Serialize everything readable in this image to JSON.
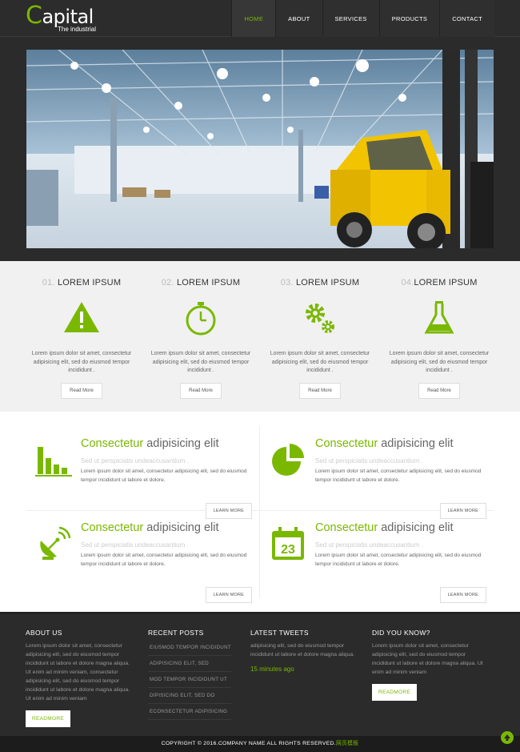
{
  "header": {
    "logo_first": "C",
    "logo_rest": "apital",
    "logo_sub": "The industrial",
    "nav": [
      "HOME",
      "ABOUT",
      "SERVICES",
      "PRODUCTS",
      "CONTACT"
    ]
  },
  "features": [
    {
      "num": "01.",
      "title": "LOREM IPSUM",
      "icon": "warning-icon",
      "text": "Lorem ipsum dolor sit amet, consectetur adipisicing elit, sed do eiusmod tempor incididunt .",
      "button": "Read More"
    },
    {
      "num": "02.",
      "title": "LOREM IPSUM",
      "icon": "stopwatch-icon",
      "text": "Lorem ipsum dolor sit amet, consectetur adipisicing elit, sed do eiusmod tempor incididunt .",
      "button": "Read More"
    },
    {
      "num": "03.",
      "title": "LOREM IPSUM",
      "icon": "gears-icon",
      "text": "Lorem ipsum dolor sit amet, consectetur adipisicing elit, sed do eiusmod tempor incididunt .",
      "button": "Read More"
    },
    {
      "num": "04.",
      "title": "LOREM IPSUM",
      "icon": "flask-icon",
      "text": "Lorem ipsum dolor sit amet, consectetur adipisicing elit, sed do eiusmod tempor incididunt .",
      "button": "Read More"
    }
  ],
  "services": [
    {
      "title_green": "Consectetur",
      "title_rest": " adipisicing elit",
      "sub": "Sed ut perspiciatis undeaccusantium .",
      "text": "Lorem ipsum dolor sit amet, consectetur adipisicing elit, sed do eiusmod tempor incididunt ut labore et dolore.",
      "button": "LEARN MORE",
      "icon": "bar-chart-icon"
    },
    {
      "title_green": "Consectetur",
      "title_rest": " adipisicing elit",
      "sub": "Sed ut perspiciatis undeaccusantium .",
      "text": "Lorem ipsum dolor sit amet, consectetur adipisicing elit, sed do eiusmod tempor incididunt ut labore et dolore.",
      "button": "LEARN MORE",
      "icon": "pie-chart-icon"
    },
    {
      "title_green": "Consectetur",
      "title_rest": " adipisicing elit",
      "sub": "Sed ut perspiciatis undeaccusantium .",
      "text": "Lorem ipsum dolor sit amet, consectetur adipisicing elit, sed do eiusmod tempor incididunt ut labore et dolore.",
      "button": "LEARN MORE",
      "icon": "satellite-dish-icon"
    },
    {
      "title_green": "Consectetur",
      "title_rest": " adipisicing elit",
      "sub": "Sed ut perspiciatis undeaccusantium .",
      "text": "Lorem ipsum dolor sit amet, consectetur adipisicing elit, sed do eiusmod tempor incididunt ut labore et dolore.",
      "button": "LEARN MORE",
      "icon": "calendar-icon",
      "calendar_day": "23"
    }
  ],
  "footer": {
    "about": {
      "title": "ABOUT US",
      "text": "Lorem ipsum dolor sit amet, consectetur adipisicing elit, sed do eiusmod tempor incididunt ut labore et dolore magna aliqua. Ut enim ad minim veniam, consectetur adipisicing elit, sed do eiusmod tempor incididunt ut labore et dolore magna aliqua. Ut enim ad minim veniam",
      "button": "READMORE"
    },
    "posts": {
      "title": "RECENT POSTS",
      "items": [
        "EIUSMOD TEMPOR INCIDIDUNT",
        "ADIPISICING ELIT, SED",
        "MOD TEMPOR INCIDIDUNT UT",
        "DIPISICING ELIT, SED DO",
        "ECONSECTETUR ADIPISICING"
      ]
    },
    "tweets": {
      "title": "LATEST TWEETS",
      "text": "adipisicing elit, sed do eiusmod tempor incididunt ut labore et dolore magna aliqua.",
      "time": "15 minutes ago"
    },
    "know": {
      "title": "DID YOU KNOW?",
      "text": "Lorem ipsum dolor sit amet, consectetur adipisicing elit, sed do eiusmod tempor incididunt ut labore et dolore magna aliqua. Ut enim ad minim veniam",
      "button": "READMORE"
    }
  },
  "copyright": {
    "text": "COPYRIGHT © 2016.COMPANY NAME ALL RIGHTS RESERVED.",
    "tag": "网页模板"
  },
  "colors": {
    "accent": "#7ab800",
    "dark": "#2b2b2b"
  }
}
